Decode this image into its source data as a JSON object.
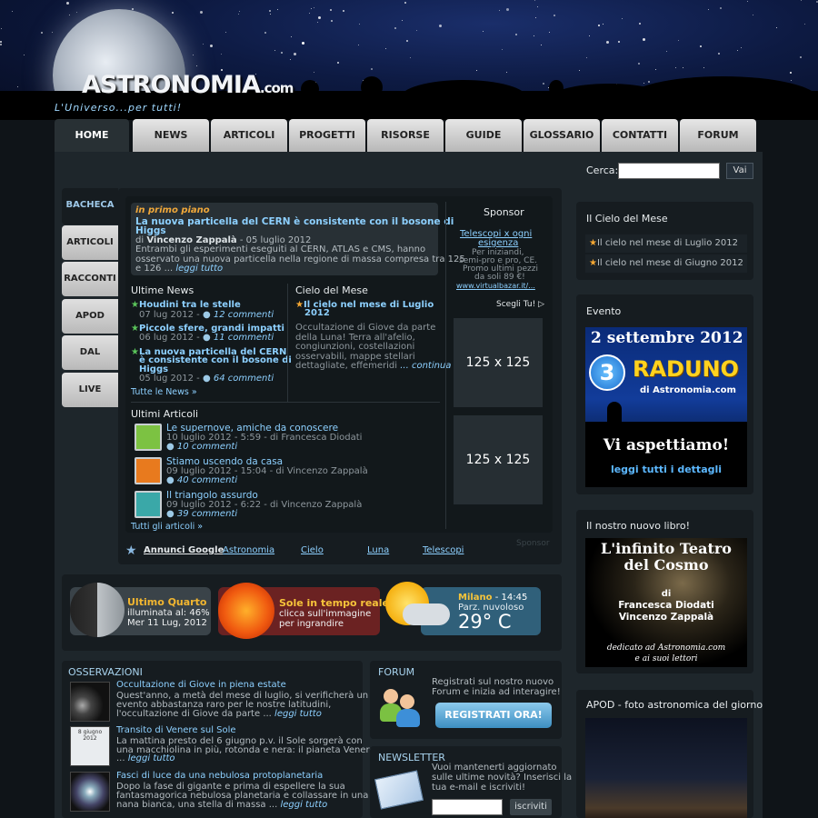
{
  "header": {
    "logo_text": "ASTRONOMIA",
    "logo_suffix": ".com",
    "tagline": "L'Universo...per tutti!"
  },
  "nav": {
    "tabs": [
      {
        "label": "HOME",
        "active": true
      },
      {
        "label": "NEWS"
      },
      {
        "label": "ARTICOLI"
      },
      {
        "label": "PROGETTI"
      },
      {
        "label": "RISORSE"
      },
      {
        "label": "GUIDE"
      },
      {
        "label": "GLOSSARIO"
      },
      {
        "label": "CONTATTI"
      },
      {
        "label": "FORUM"
      }
    ]
  },
  "search": {
    "label": "Cerca:",
    "button": "Vai",
    "value": ""
  },
  "side_tabs": [
    "BACHECA",
    "ARTICOLI",
    "RACCONTI",
    "APOD",
    "DAL FORUM",
    "LIVE"
  ],
  "featured": {
    "label": "in primo piano",
    "title_l1": "La nuova particella del CERN è consistente con il bosone di",
    "title_l2": "Higgs",
    "meta_prefix": "di",
    "author": "Vincenzo Zappalà",
    "date": " - 05 luglio 2012",
    "body_l1": "Entrambi gli esperimenti eseguiti al CERN, ATLAS e CMS, hanno",
    "body_l2": "osservato una nuova particella nella regione di massa compresa tra 125",
    "body_l3": "e 126 ...",
    "more": "leggi tutto"
  },
  "news": {
    "title": "Ultime News",
    "items": [
      {
        "l1": "Houdini tra le stelle",
        "date": "07 lug 2012 -",
        "comments": "12 commenti"
      },
      {
        "l1": "Piccole sfere, grandi impatti",
        "date": "06 lug 2012 -",
        "comments": "11 commenti"
      },
      {
        "l1": "La nuova particella del CERN",
        "l2": "è consistente con il bosone di",
        "l3": "Higgs",
        "date": "05 lug 2012 -",
        "comments": "64 commenti"
      }
    ],
    "all": "Tutte le News »"
  },
  "sky": {
    "title": "Cielo del Mese",
    "link_l1": "Il cielo nel mese di Luglio",
    "link_l2": "2012",
    "body": [
      "Occultazione di Giove da parte",
      "della Luna! Terra all'afelio,",
      "congiunzioni, costellazioni",
      "osservabili, mappe stellari",
      "dettagliate, effemeridi"
    ],
    "more": "... continua"
  },
  "articles": {
    "title": "Ultimi Articoli",
    "items": [
      {
        "title": "Le supernove, amiche da conoscere",
        "meta": "10 luglio 2012 - 5:59 - di Francesca Diodati",
        "comments": "10 commenti",
        "color": "#7cc242"
      },
      {
        "title": "Stiamo uscendo da casa",
        "meta": "09 luglio 2012 - 15:04 - di Vincenzo Zappalà",
        "comments": "40 commenti",
        "color": "#e87a1e"
      },
      {
        "title": "Il triangolo assurdo",
        "meta": "09 luglio 2012 - 6:22 - di Vincenzo Zappalà",
        "comments": "39 commenti",
        "color": "#3aa8a8"
      }
    ],
    "all": "Tutti gli articoli »"
  },
  "sponsor": {
    "title": "Sponsor",
    "link_l1": "Telescopi x ogni",
    "link_l2": "esigenza",
    "body": [
      "Per iniziandi,",
      "semi-pro e pro, CE.",
      "Promo ultimi pezzi",
      "da soli 89 €!"
    ],
    "url": "www.virtualbazar.it/...",
    "choose": "Scegli Tu!",
    "ad1": "125 x 125",
    "ad2": "125 x 125",
    "bottom": "Sponsor"
  },
  "google": {
    "label": "Annunci Google",
    "links": [
      "Astronomia",
      "Cielo",
      "Luna",
      "Telescopi"
    ]
  },
  "widgets": {
    "moon": {
      "title": "Ultimo Quarto",
      "l2": "illuminata al: 46%",
      "l3": "Mer 11 Lug, 2012"
    },
    "sun": {
      "title": "Sole in tempo reale",
      "l2": "clicca sull'immagine",
      "l3": "per ingrandire"
    },
    "weather": {
      "city": "Milano",
      "time": "- 14:45",
      "cond": "Parz. nuvoloso",
      "temp": "29° C"
    }
  },
  "observations": {
    "title": "OSSERVAZIONI",
    "items": [
      {
        "title": "Occultazione di Giove in piena estate",
        "body": [
          "Quest'anno, a metà del mese di luglio, si verificherà un",
          "evento abbastanza raro per le nostre latitudini,",
          "l'occultazione di Giove da parte ..."
        ],
        "more": "leggi tutto"
      },
      {
        "title": "Transito di Venere sul Sole",
        "body": [
          "La mattina presto del 6 giugno p.v. il Sole sorgerà con",
          "una macchiolina in più, rotonda e nera: il pianeta Venere."
        ],
        "prefix": "...",
        "more": "leggi tutto",
        "thumb": "8 giugno 2012"
      },
      {
        "title": "Fasci di luce da una nebulosa protoplanetaria",
        "body": [
          "Dopo la fase di gigante e prima di espellere la sua",
          "fantasmagorica nebulosa planetaria e collassare in una",
          "nana bianca, una stella di massa ..."
        ],
        "more": "leggi tutto"
      }
    ]
  },
  "forum": {
    "title": "FORUM",
    "text": [
      "Registrati sul nostro nuovo",
      "Forum e inizia ad interagire!"
    ],
    "button": "REGISTRATI ORA!"
  },
  "newsletter": {
    "title": "NEWSLETTER",
    "text": [
      "Vuoi mantenerti aggiornato",
      "sulle ultime novità? Inserisci la",
      "tua e-mail e iscriviti!"
    ],
    "button": "iscriviti",
    "value": ""
  },
  "right": {
    "sky_title": "Il Cielo del Mese",
    "sky_items": [
      "Il cielo nel mese di Luglio 2012",
      "Il cielo nel mese di Giugno 2012"
    ],
    "event_title": "Evento",
    "event": {
      "date": "2 settembre 2012",
      "number": "3",
      "raduno": "RADUNO",
      "site": "di Astronomia.com",
      "cta": "Vi aspettiamo!",
      "more": "leggi tutti i dettagli"
    },
    "book_title": "Il nostro nuovo libro!",
    "book": {
      "l1": "L'infinito Teatro",
      "l2": "del Cosmo",
      "di": "di",
      "a1": "Francesca Diodati",
      "a2": "Vincenzo Zappalà",
      "d1": "dedicato ad Astronomia.com",
      "d2": "e ai suoi lettori"
    },
    "apod_title": "APOD - foto astronomica del giorno"
  },
  "colors": {
    "accent_blue": "#8dd0ff",
    "accent_orange": "#f0a83a",
    "page_bg": "#1e262b"
  }
}
